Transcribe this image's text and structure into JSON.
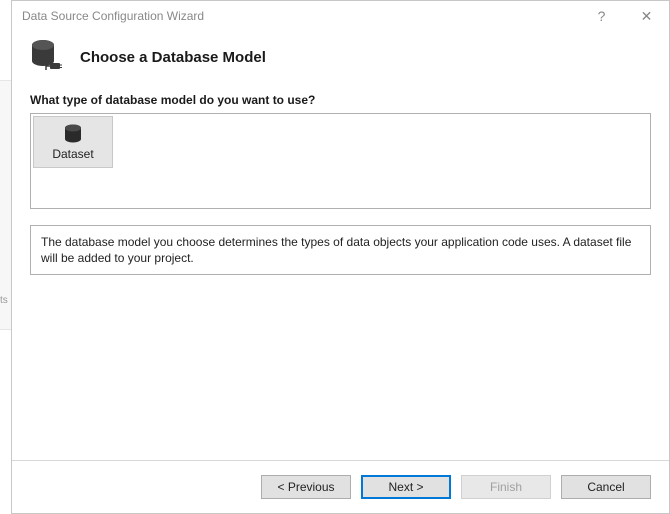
{
  "titlebar": {
    "title": "Data Source Configuration Wizard",
    "help_label": "?",
    "close_label": "✕"
  },
  "header": {
    "title": "Choose a Database Model"
  },
  "content": {
    "prompt": "What type of database model do you want to use?",
    "options": [
      {
        "label": "Dataset",
        "icon": "database-icon"
      }
    ],
    "description": "The database model you choose determines the types of data objects your application code uses. A dataset file will be added to your project."
  },
  "footer": {
    "previous_label": "< Previous",
    "next_label": "Next >",
    "finish_label": "Finish",
    "cancel_label": "Cancel"
  },
  "bg_fragment": "ts"
}
